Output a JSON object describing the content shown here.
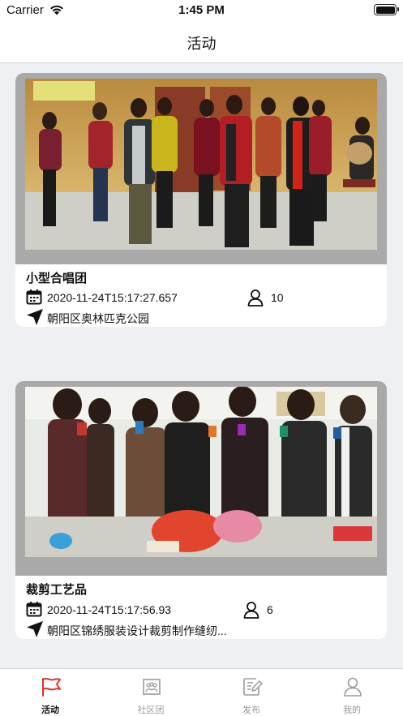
{
  "status_bar": {
    "carrier": "Carrier",
    "time": "1:45 PM"
  },
  "nav": {
    "title": "活动"
  },
  "activities": [
    {
      "title": "小型合唱团",
      "datetime": "2020-11-24T15:17:27.657",
      "count": "10",
      "location": "朝阳区奥林匹克公园"
    },
    {
      "title": "裁剪工艺品",
      "datetime": "2020-11-24T15:17:56.93",
      "count": "6",
      "location": "朝阳区锦绣服装设计裁剪制作缝纫..."
    }
  ],
  "tabs": [
    {
      "label": "活动",
      "icon": "flag-icon",
      "active": true
    },
    {
      "label": "社区团",
      "icon": "group-photo-icon",
      "active": false
    },
    {
      "label": "发布",
      "icon": "edit-note-icon",
      "active": false
    },
    {
      "label": "我的",
      "icon": "person-icon",
      "active": false
    }
  ],
  "colors": {
    "accent": "#d9302c",
    "inactive": "#9a9a9a",
    "background": "#eef0f3"
  }
}
